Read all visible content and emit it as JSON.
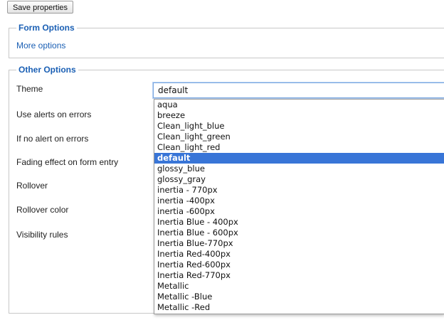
{
  "toolbar": {
    "save_label": "Save properties"
  },
  "form_options": {
    "legend": "Form Options",
    "more_link": "More options"
  },
  "other_options": {
    "legend": "Other Options",
    "rows": [
      "Theme",
      "Use alerts on errors",
      "If no alert on errors",
      "Fading effect on form entry",
      "Rollover",
      "Rollover color",
      "Visibility rules"
    ]
  },
  "theme_select": {
    "value": "default",
    "options": [
      "aqua",
      "breeze",
      "Clean_light_blue",
      "Clean_light_green",
      "Clean_light_red",
      "default",
      "glossy_blue",
      "glossy_gray",
      "inertia - 770px",
      "inertia -400px",
      "inertia -600px",
      "Inertia Blue - 400px",
      "Inertia Blue - 600px",
      "Inertia Blue-770px",
      "Inertia Red-400px",
      "Inertia Red-600px",
      "Inertia Red-770px",
      "Metallic",
      "Metallic -Blue",
      "Metallic -Red"
    ],
    "selected_index": 5
  },
  "colors": {
    "accent": "#1a5fb4",
    "selection": "#3875d7"
  }
}
